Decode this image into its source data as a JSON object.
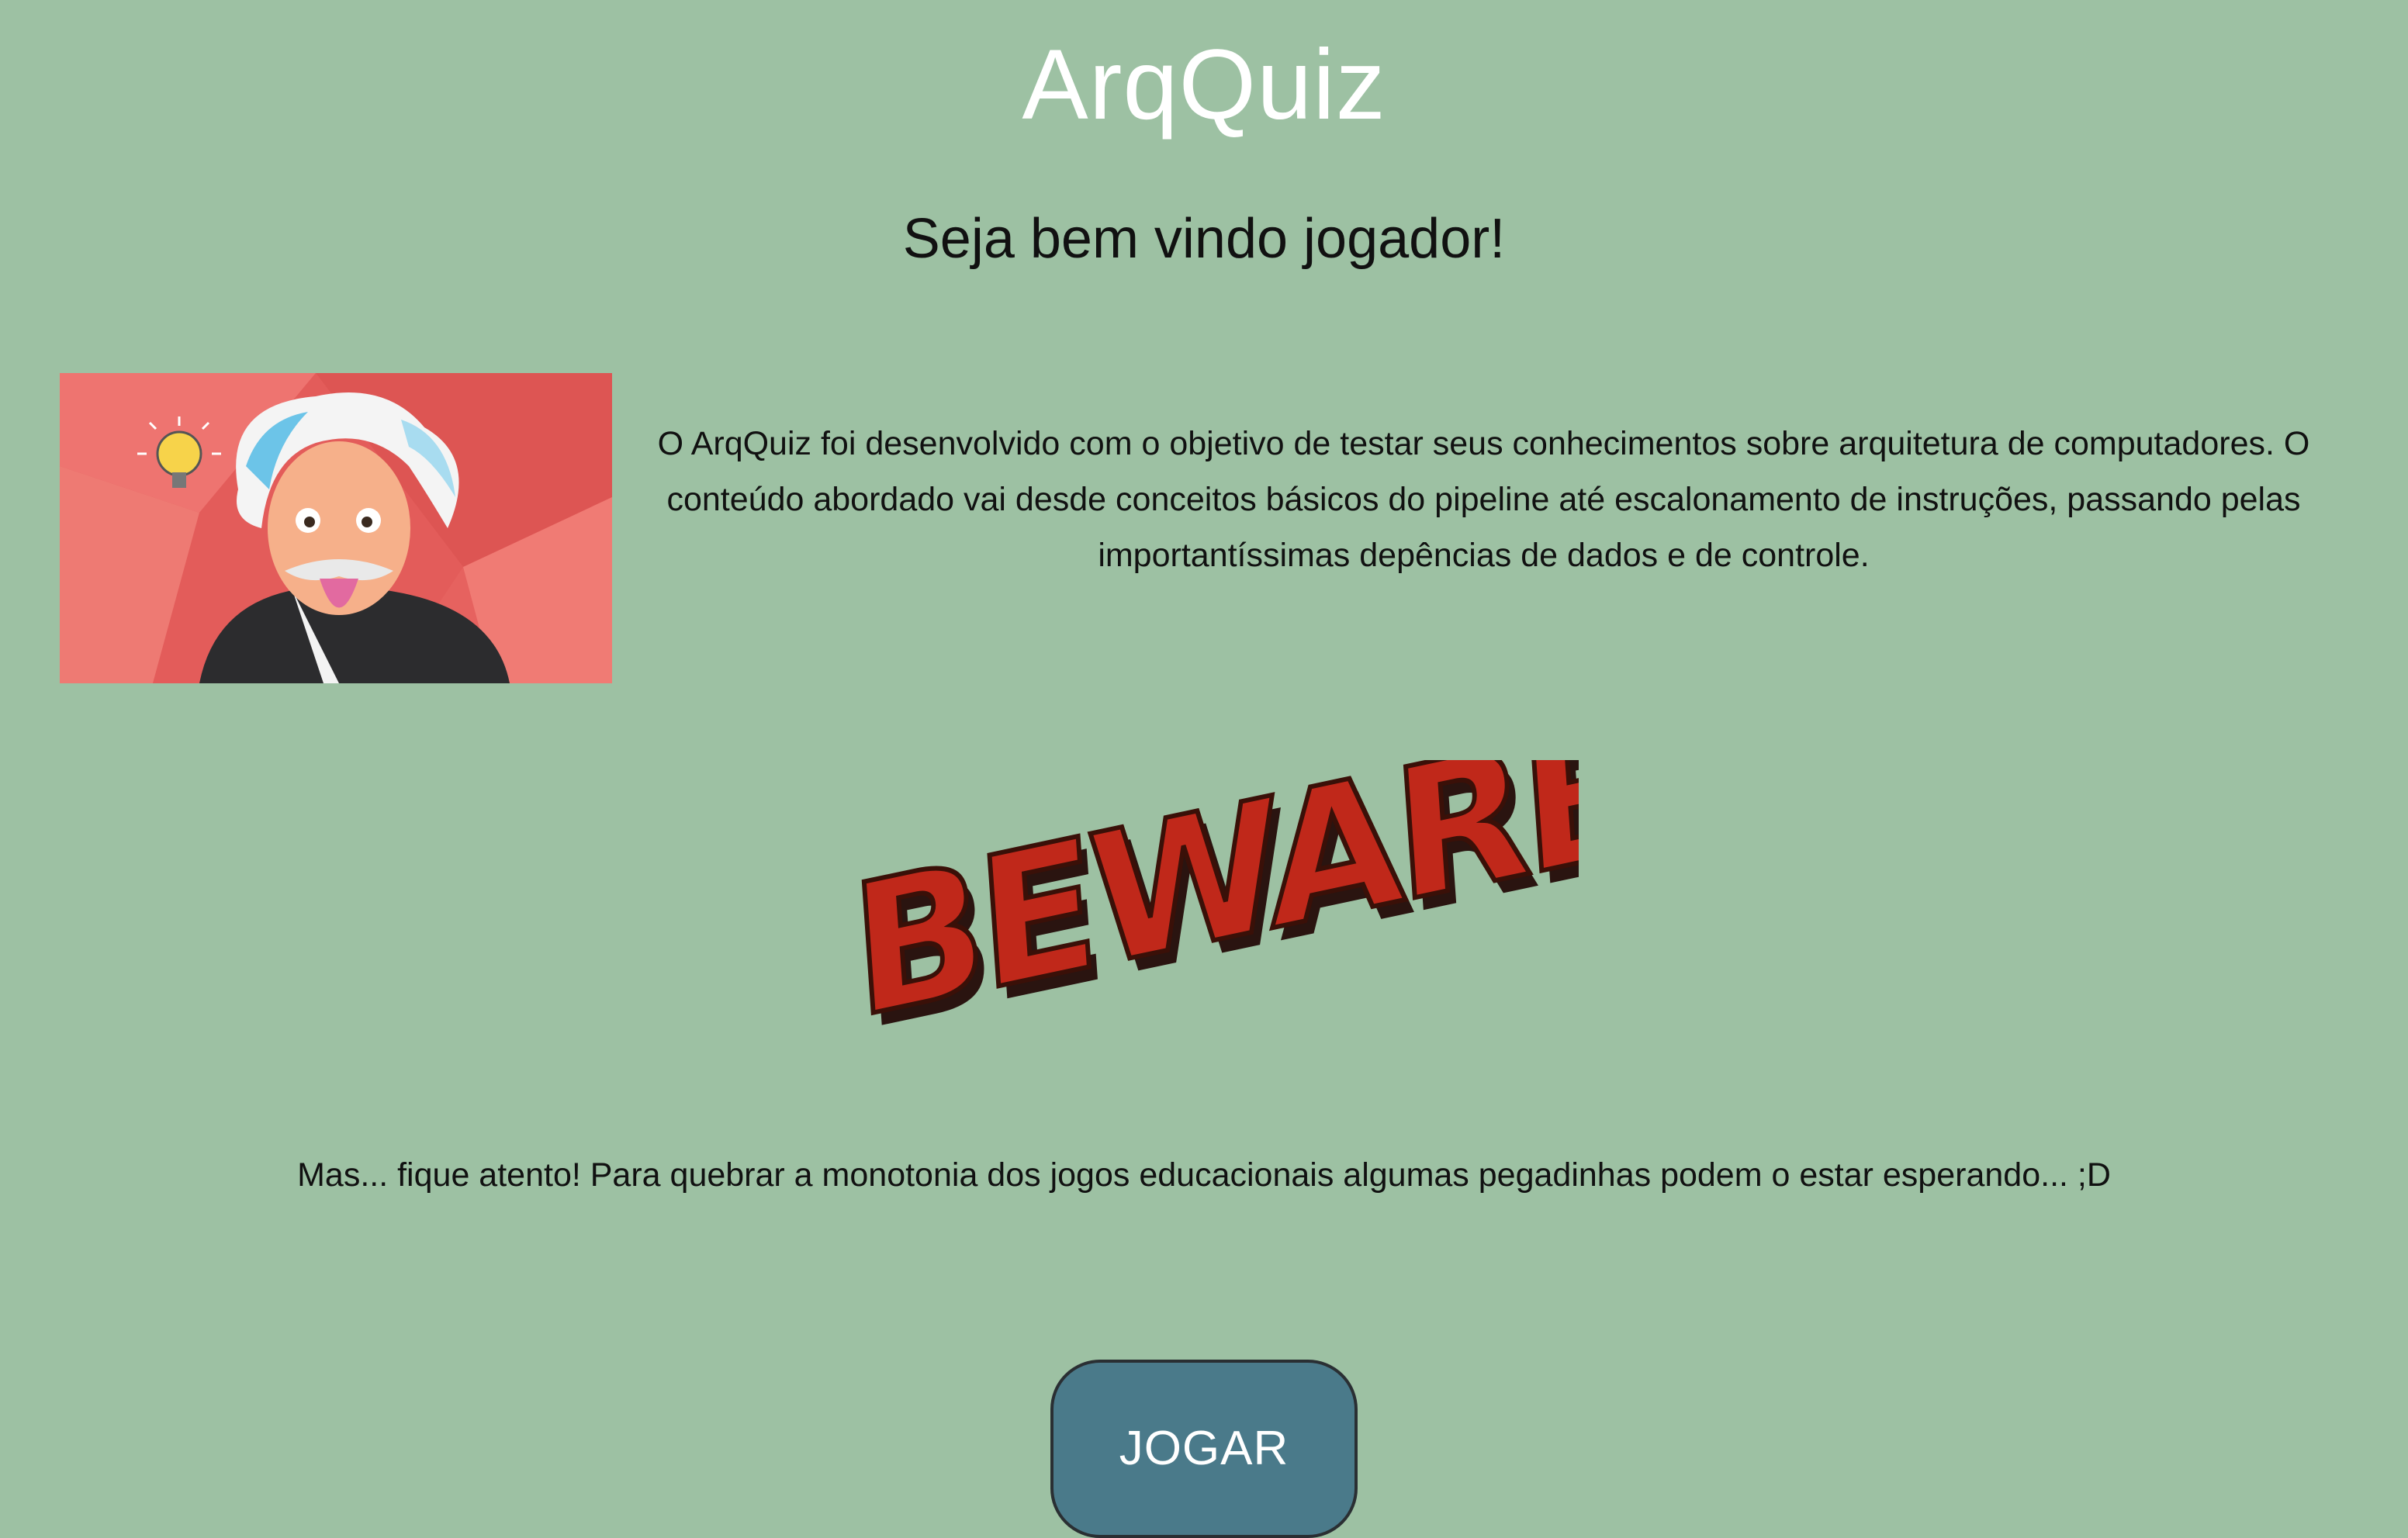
{
  "page": {
    "title": "ArqQuiz",
    "subtitle": "Seja bem vindo jogador!",
    "intro": "O ArqQuiz foi desenvolvido com o objetivo de testar seus conhecimentos sobre arquitetura de computadores. O conteúdo abordado vai desde conceitos básicos do pipeline até escalonamento de instruções, passando pelas importantíssimas depências de dados e de controle.",
    "warning": "Mas... fique atento! Para quebrar a monotonia dos jogos educacionais algumas pegadinhas podem o estar esperando... ;D",
    "play_label": "JOGAR"
  },
  "images": {
    "hero": "einstein-tongue-illustration",
    "beware": "beware-graphic-text",
    "beware_text": "BEWARE..."
  },
  "colors": {
    "background": "#9dc1a3",
    "title": "#ffffff",
    "text": "#111111",
    "button_bg": "#4a7a8a",
    "button_border": "#2a2f33",
    "beware_red": "#c0281a",
    "hero_bg": "#e6625f"
  }
}
